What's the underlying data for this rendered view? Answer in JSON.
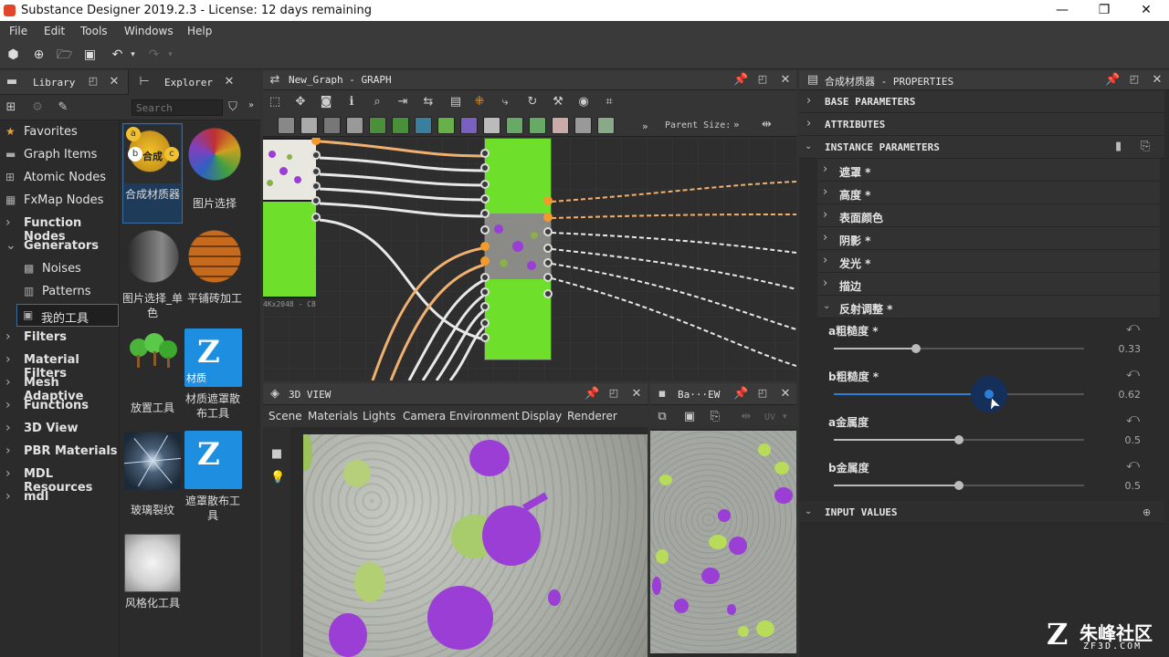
{
  "window": {
    "title": "Substance Designer 2019.2.3 - License: 12 days remaining",
    "minimize": "—",
    "maximize": "❐",
    "close": "✕"
  },
  "menu": [
    "File",
    "Edit",
    "Tools",
    "Windows",
    "Help"
  ],
  "library": {
    "tab_library": "Library",
    "tab_explorer": "Explorer",
    "search_placeholder": "Search",
    "items": [
      {
        "label": "Favorites",
        "icon": "star-icon",
        "bold": false
      },
      {
        "label": "Graph Items",
        "icon": "graph-icon",
        "bold": false
      },
      {
        "label": "Atomic Nodes",
        "icon": "atomic-icon",
        "bold": false
      },
      {
        "label": "FxMap Nodes",
        "icon": "fxmap-icon",
        "bold": false
      },
      {
        "label": "Function Nodes",
        "icon": "chevron-right-icon",
        "bold": true
      },
      {
        "label": "Generators",
        "icon": "chevron-down-icon",
        "bold": true
      },
      {
        "label": "Noises",
        "icon": "noise-icon",
        "bold": false
      },
      {
        "label": "Patterns",
        "icon": "pattern-icon",
        "bold": false
      },
      {
        "label": "我的工具",
        "icon": "tool-icon",
        "bold": false
      },
      {
        "label": "Filters",
        "icon": "chevron-right-icon",
        "bold": true
      },
      {
        "label": "Material Filters",
        "icon": "chevron-right-icon",
        "bold": true
      },
      {
        "label": "Mesh Adaptive",
        "icon": "chevron-right-icon",
        "bold": true
      },
      {
        "label": "Functions",
        "icon": "chevron-right-icon",
        "bold": true
      },
      {
        "label": "3D View",
        "icon": "chevron-right-icon",
        "bold": true
      },
      {
        "label": "PBR Materials",
        "icon": "chevron-right-icon",
        "bold": true
      },
      {
        "label": "MDL Resources",
        "icon": "chevron-right-icon",
        "bold": true
      },
      {
        "label": "mdl",
        "icon": "chevron-right-icon",
        "bold": true
      }
    ],
    "thumbnails": [
      {
        "label": "合成材质器",
        "badge": "合成"
      },
      {
        "label": "图片选择",
        "badge": ""
      },
      {
        "label": "图片选择_单色",
        "badge": ""
      },
      {
        "label": "平铺砖加工",
        "badge": ""
      },
      {
        "label": "放置工具",
        "badge": ""
      },
      {
        "label": "材质遮罩散布工具",
        "badge": "材质"
      },
      {
        "label": "玻璃裂纹",
        "badge": ""
      },
      {
        "label": "遮罩散布工具",
        "badge": ""
      },
      {
        "label": "风格化工具",
        "badge": ""
      }
    ]
  },
  "graph": {
    "title": "New_Graph - GRAPH",
    "parent_size_label": "Parent Size:",
    "node_caption": "4Kx2048 - C8"
  },
  "view3d": {
    "title": "3D VIEW",
    "menu": [
      "Scene",
      "Materials",
      "Lights",
      "Camera",
      "Environment",
      "Display",
      "Renderer"
    ]
  },
  "view2d": {
    "title": "Ba···EW",
    "uv_label": "UV"
  },
  "properties": {
    "title": "合成材质器 - PROPERTIES",
    "sections": {
      "base": "BASE PARAMETERS",
      "attributes": "ATTRIBUTES",
      "instance": "INSTANCE PARAMETERS",
      "input": "INPUT VALUES"
    },
    "groups": [
      "遮罩 *",
      "高度 *",
      "表面颜色",
      "阴影 *",
      "发光 *",
      "描边",
      "反射调整 *"
    ],
    "params": [
      {
        "label": "a粗糙度 *",
        "value": "0.33",
        "fraction": 0.33,
        "active": false
      },
      {
        "label": "b粗糙度 *",
        "value": "0.62",
        "fraction": 0.62,
        "active": true
      },
      {
        "label": "a金属度",
        "value": "0.5",
        "fraction": 0.5,
        "active": false
      },
      {
        "label": "b金属度",
        "value": "0.5",
        "fraction": 0.5,
        "active": false
      }
    ]
  },
  "watermark": {
    "text": "朱峰社区",
    "sub": "ZF3D.COM"
  },
  "colors": {
    "accent": "#f39b2a",
    "node_green": "#6ee02c",
    "slider_active": "#2b7fd6",
    "purple": "#9a3ed6"
  }
}
